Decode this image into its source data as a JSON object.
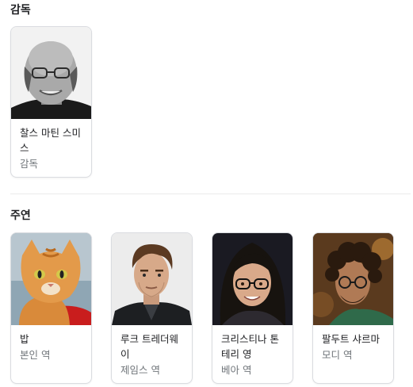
{
  "director_section": {
    "title": "감독",
    "people": [
      {
        "name": "찰스 마틴 스미스",
        "role": "감독",
        "photo_icon": "person-photo-bald-glasses-man"
      }
    ]
  },
  "cast_section": {
    "title": "주연",
    "people": [
      {
        "name": "밥",
        "role": "본인 역",
        "photo_icon": "person-photo-orange-cat"
      },
      {
        "name": "루크 트레더웨이",
        "role": "제임스 역",
        "photo_icon": "person-photo-man-dark-jacket"
      },
      {
        "name": "크리스티나 톤테리 영",
        "role": "베아 역",
        "photo_icon": "person-photo-woman-glasses"
      },
      {
        "name": "팔두트 샤르마",
        "role": "모디 역",
        "photo_icon": "person-photo-man-curly-hair"
      }
    ]
  },
  "colors": {
    "title": "#202124",
    "secondary_text": "#70757a",
    "card_border": "#dadce0",
    "divider": "#ebebeb"
  }
}
